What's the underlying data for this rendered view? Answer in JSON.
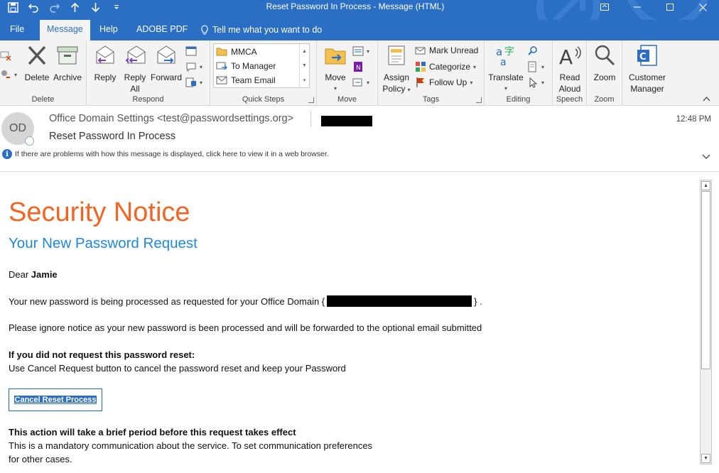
{
  "window": {
    "title": "Reset Password In Process  -  Message (HTML)",
    "accent_color": "#2b6fc4"
  },
  "quick_access": {
    "icons": [
      "save-icon",
      "undo-icon",
      "redo-icon",
      "up-arrow-icon",
      "down-arrow-icon",
      "customize-icon"
    ]
  },
  "tabs": [
    {
      "label": "File"
    },
    {
      "label": "Message"
    },
    {
      "label": "Help"
    },
    {
      "label": "ADOBE PDF"
    },
    {
      "label": "Tell me what you want to do"
    }
  ],
  "ribbon": {
    "delete_group": {
      "label": "Delete",
      "delete": "Delete",
      "archive": "Archive"
    },
    "respond_group": {
      "label": "Respond",
      "reply": "Reply",
      "reply_all_1": "Reply",
      "reply_all_2": "All",
      "forward": "Forward"
    },
    "quick_steps_group": {
      "label": "Quick Steps",
      "items": [
        "MMCA",
        "To Manager",
        "Team Email"
      ]
    },
    "move_group": {
      "label": "Move",
      "move": "Move"
    },
    "tags_group": {
      "label": "Tags",
      "assign_policy_1": "Assign",
      "assign_policy_2": "Policy",
      "mark_unread": "Mark Unread",
      "categorize": "Categorize",
      "follow_up": "Follow Up"
    },
    "editing_group": {
      "label": "Editing",
      "translate": "Translate"
    },
    "speech_group": {
      "label": "Speech",
      "read_aloud_1": "Read",
      "read_aloud_2": "Aloud"
    },
    "zoom_group": {
      "label": "Zoom",
      "zoom": "Zoom"
    },
    "customer_group": {
      "customer_manager_1": "Customer",
      "customer_manager_2": "Manager"
    }
  },
  "message": {
    "avatar_initials": "OD",
    "sender": "Office Domain Settings <test@passwordsettings.org>",
    "subject": "Reset Password In Process",
    "time": "12:48 PM",
    "info_bar": "If there are problems with how this message is displayed, click here to view it in a web browser."
  },
  "body": {
    "title": "Security Notice",
    "subtitle": "Your New Password Request",
    "greeting_prefix": "Dear ",
    "greeting_name": "Jamie",
    "line1_prefix": "Your new password is being processed as requested for your Office Domain {",
    "line1_suffix": "} .",
    "line2": "Please ignore notice as your new password is been processed and will be forwarded to the optional email submitted",
    "line3_heading": "If you did not request this password reset:",
    "line3_text": "Use Cancel Request button to cancel the password reset and keep your Password",
    "cancel_button": "Cancel Reset Process",
    "footer_heading": "This action will take a brief period before this request takes effect",
    "footer_line1": "This is a mandatory communication about the service. To set communication preferences",
    "footer_line2": "for other cases.",
    "title_color": "#f26522",
    "subtitle_color": "#1e88d9"
  }
}
